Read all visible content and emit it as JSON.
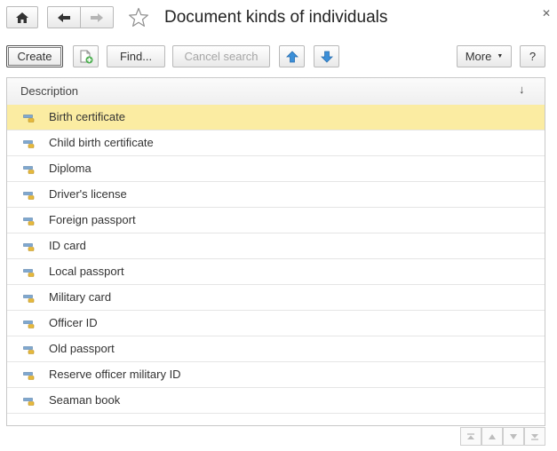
{
  "window": {
    "title": "Document kinds of individuals"
  },
  "toolbar": {
    "create_label": "Create",
    "find_label": "Find...",
    "cancel_search_label": "Cancel search",
    "more_label": "More",
    "help_label": "?"
  },
  "list": {
    "column_header": "Description",
    "sort_indicator": "↓",
    "selected_index": 0,
    "items": [
      {
        "label": "Birth certificate"
      },
      {
        "label": "Child birth certificate"
      },
      {
        "label": "Diploma"
      },
      {
        "label": "Driver's license"
      },
      {
        "label": "Foreign passport"
      },
      {
        "label": "ID card"
      },
      {
        "label": "Local passport"
      },
      {
        "label": "Military card"
      },
      {
        "label": "Officer ID"
      },
      {
        "label": "Old passport"
      },
      {
        "label": "Reserve officer military ID"
      },
      {
        "label": "Seaman book"
      }
    ]
  },
  "colors": {
    "selected_row": "#fbeca2",
    "arrow_blue": "#3b8fd8"
  }
}
